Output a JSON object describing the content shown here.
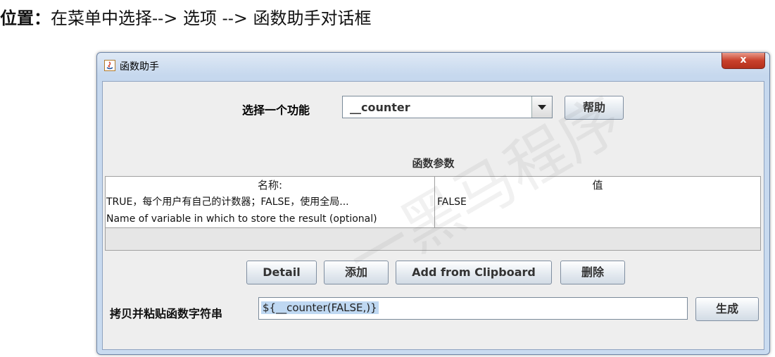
{
  "caption": {
    "label": "位置：",
    "text": "在菜单中选择--> 选项 --> 函数助手对话框"
  },
  "watermark": "一黑马程序",
  "window": {
    "title": "函数助手",
    "close_label": "x"
  },
  "function_select": {
    "label": "选择一个功能",
    "value": "__counter",
    "help_button": "帮助"
  },
  "params": {
    "title": "函数参数",
    "columns": [
      "名称:",
      "值"
    ],
    "rows": [
      {
        "name": "TRUE，每个用户有自己的计数器；FALSE，使用全局...",
        "value": "FALSE"
      },
      {
        "name": "Name of variable in which to store the result (optional)",
        "value": ""
      }
    ]
  },
  "buttons": {
    "detail": "Detail",
    "add": "添加",
    "add_clipboard": "Add from Clipboard",
    "delete": "删除"
  },
  "copy": {
    "label": "拷贝并粘贴函数字符串",
    "value": "${__counter(FALSE,)}",
    "generate_button": "生成"
  }
}
